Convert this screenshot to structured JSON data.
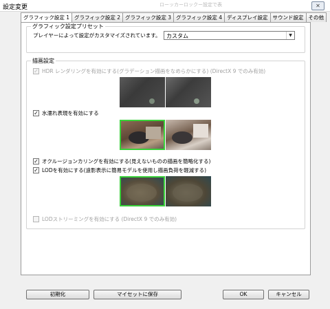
{
  "window": {
    "title": "設定変更",
    "behind_text": "ローッカーロックー設定で表"
  },
  "tabs": [
    "グラフィック設定 1",
    "グラフィック設定 2",
    "グラフィック設定 3",
    "グラフィック設定 4",
    "ディスプレイ設定",
    "サウンド設定",
    "その他"
  ],
  "preset": {
    "legend": "グラフィック設定プリセット",
    "label": "プレイヤーによって設定がカスタマイズされています。",
    "selected": "カスタム"
  },
  "render": {
    "legend": "描画設定",
    "options": {
      "hdr": {
        "label": "HDR レンダリングを有効にする(グラデーション描画をなめらかにする) (DirectX 9 でのみ有効)",
        "checked": true,
        "enabled": false
      },
      "wet": {
        "label": "水濡れ表現を有効にする",
        "checked": true,
        "enabled": true
      },
      "occlusion": {
        "label": "オクルージョンカリングを有効にする(見えないものの描画を簡略化する)",
        "checked": true,
        "enabled": true
      },
      "lod": {
        "label": "LODを有効にする(遠影表示に簡易モデルを使用し描画負荷を軽減する)",
        "checked": true,
        "enabled": true
      },
      "lod_stream": {
        "label": "LODストリーミングを有効にする (DirectX 9 でのみ有効)",
        "checked": false,
        "enabled": false
      }
    }
  },
  "buttons": {
    "reset": "初期化",
    "save_preset": "マイセットに保存",
    "ok": "OK",
    "cancel": "キャンセル"
  },
  "colors": {
    "highlight": "#38d038",
    "background": "#f0f0f0",
    "panel": "#ffffff"
  }
}
